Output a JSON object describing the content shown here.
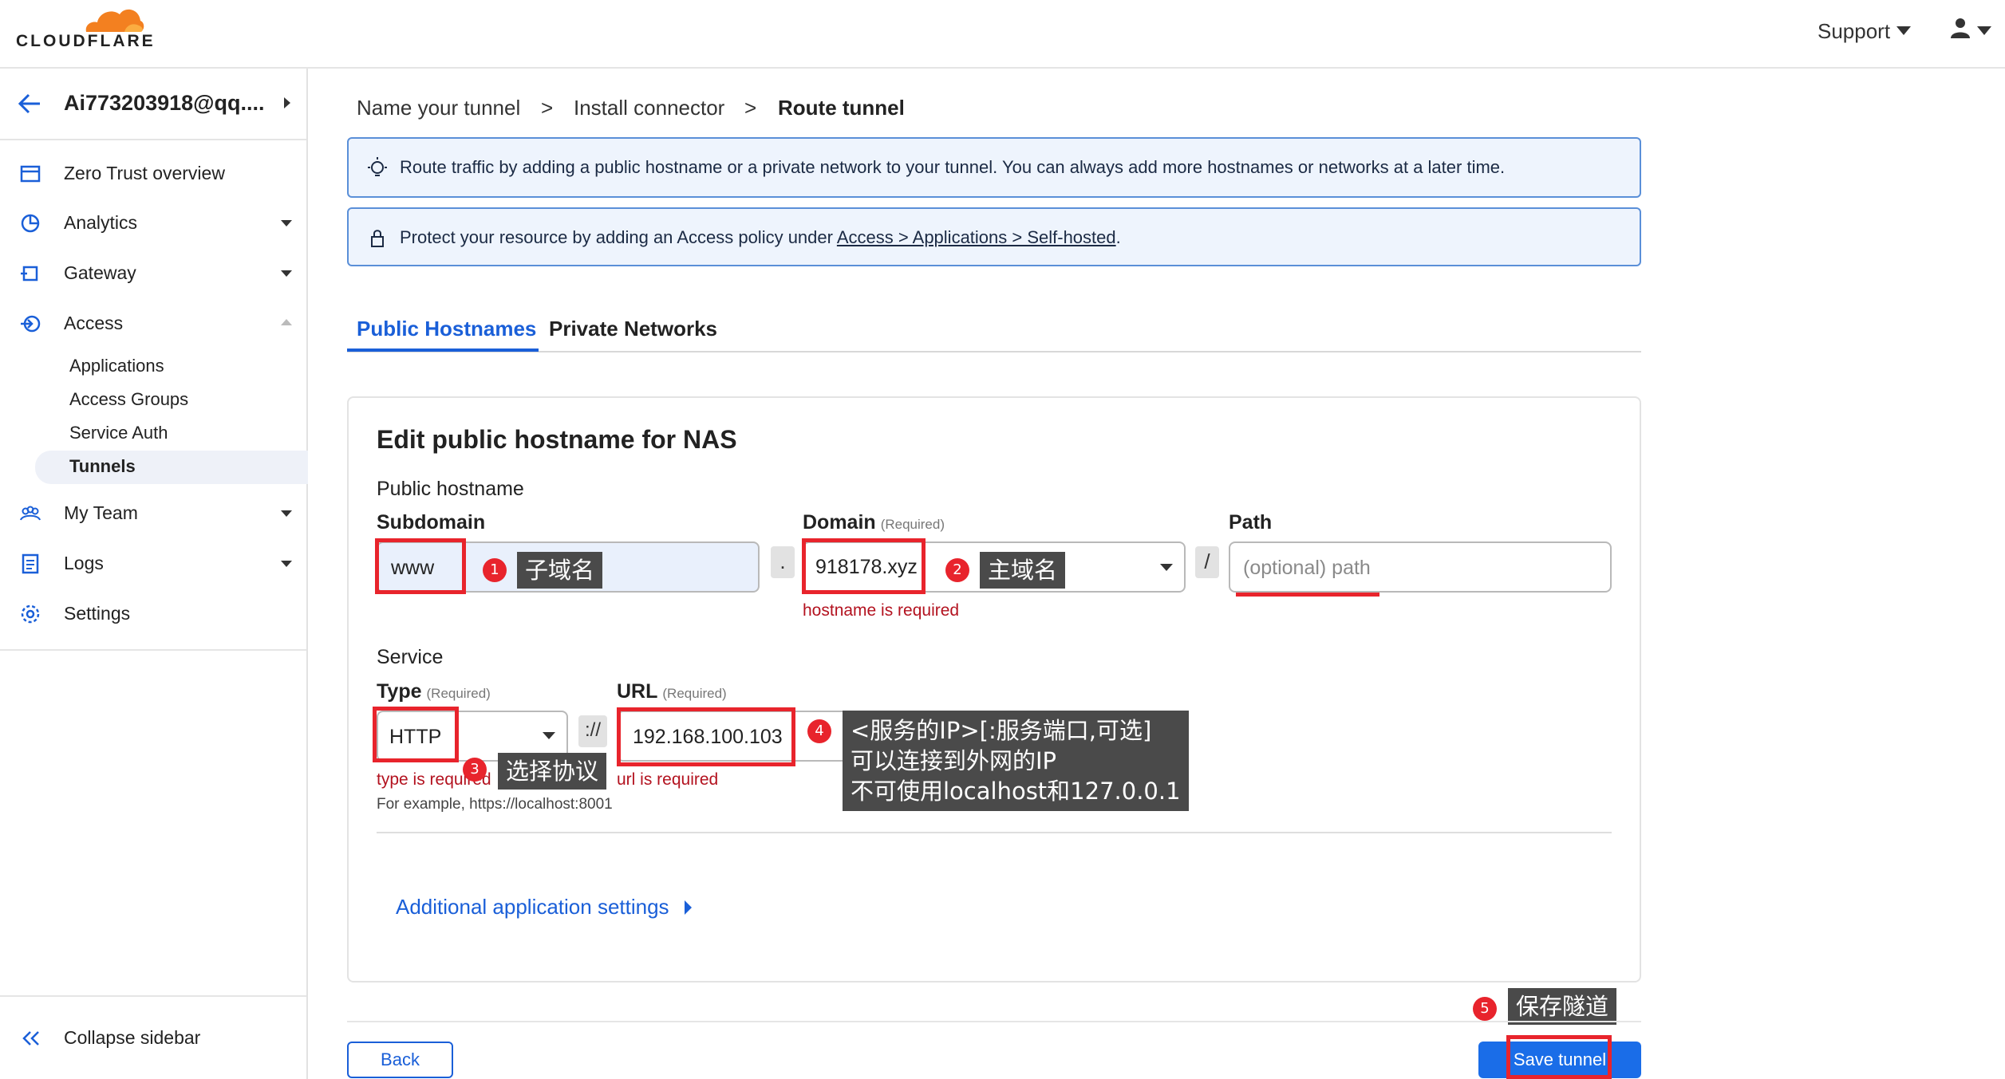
{
  "brand": {
    "logo_text": "CLOUDFLARE",
    "accent": "#f38020",
    "primary": "#1a5fd8"
  },
  "header": {
    "support_label": "Support"
  },
  "sidebar": {
    "account": "Ai773203918@qq....",
    "items": [
      {
        "label": "Zero Trust overview",
        "icon": "overview-icon"
      },
      {
        "label": "Analytics",
        "icon": "analytics-icon"
      },
      {
        "label": "Gateway",
        "icon": "gateway-icon"
      },
      {
        "label": "Access",
        "icon": "access-icon"
      },
      {
        "label": "My Team",
        "icon": "team-icon"
      },
      {
        "label": "Logs",
        "icon": "logs-icon"
      },
      {
        "label": "Settings",
        "icon": "gear-icon"
      }
    ],
    "access_sub": [
      "Applications",
      "Access Groups",
      "Service Auth",
      "Tunnels"
    ],
    "collapse_label": "Collapse sidebar"
  },
  "breadcrumb": {
    "step1": "Name your tunnel",
    "sep1": ">",
    "step2": "Install connector",
    "sep2": ">",
    "step3": "Route tunnel"
  },
  "info": {
    "route_text": "Route traffic by adding a public hostname or a private network to your tunnel. You can always add more hostnames or networks at a later time.",
    "protect_prefix": "Protect your resource by adding an Access policy under ",
    "protect_link": "Access > Applications > Self-hosted",
    "protect_suffix": "."
  },
  "tabs": {
    "public": "Public Hostnames",
    "private": "Private Networks"
  },
  "form": {
    "title": "Edit public hostname for NAS",
    "public_hostname_label": "Public hostname",
    "subdomain_label": "Subdomain",
    "subdomain_value": "www",
    "dot": ".",
    "domain_label": "Domain",
    "required": "(Required)",
    "domain_value": "918178.xyz",
    "domain_error": "hostname is required",
    "slash": "/",
    "path_label": "Path",
    "path_placeholder": "(optional) path",
    "service_label": "Service",
    "type_label": "Type",
    "type_value": "HTTP",
    "type_error": "type is required",
    "type_hint": "For example, https://localhost:8001",
    "scheme_sep": "://",
    "url_label": "URL",
    "url_value": "192.168.100.103",
    "url_error": "url is required",
    "additional_settings": "Additional application settings"
  },
  "annotations": {
    "a1": {
      "num": "1",
      "text": "子域名"
    },
    "a2": {
      "num": "2",
      "text": "主域名"
    },
    "a3": {
      "num": "3",
      "text": "选择协议"
    },
    "a4": {
      "num": "4",
      "lines": [
        "<服务的IP>[:服务端口,可选]",
        "可以连接到外网的IP",
        "不可使用localhost和127.0.0.1"
      ]
    },
    "a5": {
      "num": "5",
      "text": "保存隧道"
    }
  },
  "buttons": {
    "back": "Back",
    "save": "Save tunnel"
  }
}
